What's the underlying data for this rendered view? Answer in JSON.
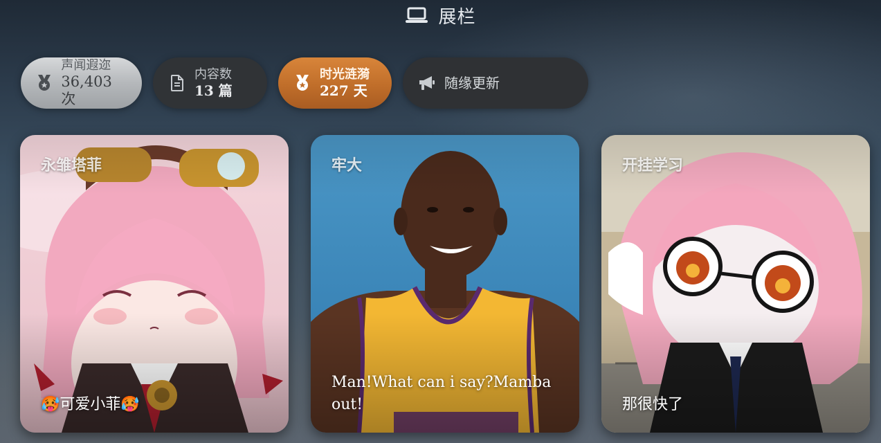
{
  "header": {
    "title": "展栏",
    "icon": "laptop-icon"
  },
  "stats": [
    {
      "label": "声闻遐迩",
      "value": "36,403 次",
      "icon": "medal-icon",
      "style": "silver"
    },
    {
      "label": "内容数",
      "value": "13 篇",
      "icon": "document-icon",
      "style": "dark"
    },
    {
      "label": "时光涟漪",
      "value": "227 天",
      "icon": "medal-icon",
      "style": "bronze"
    },
    {
      "label": "随缘更新",
      "icon": "megaphone-icon",
      "style": "dark-wide"
    }
  ],
  "cards": [
    {
      "title": "永雏塔菲",
      "caption": "🥵可爱小菲🥵"
    },
    {
      "title": "牢大",
      "caption": "Man!What can i say?Mamba out!"
    },
    {
      "title": "开挂学习",
      "caption": "那很快了"
    }
  ],
  "colors": {
    "silver": "#b5b8bb",
    "bronze": "#c06e2a",
    "dark_chip": "#303336"
  }
}
